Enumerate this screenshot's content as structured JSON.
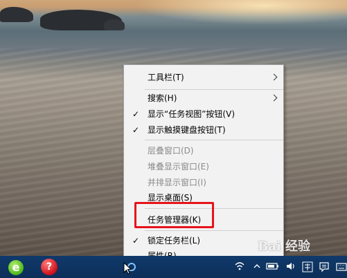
{
  "context_menu": {
    "items": [
      {
        "label": "工具栏(T)",
        "submenu": true
      },
      {
        "label": "搜索(H)",
        "submenu": true
      },
      {
        "label": "显示“任务视图”按钮(V)",
        "checked": true
      },
      {
        "label": "显示触摸键盘按钮(T)",
        "checked": true
      },
      {
        "label": "层叠窗口(D)",
        "disabled": true
      },
      {
        "label": "堆叠显示窗口(E)",
        "disabled": true
      },
      {
        "label": "并排显示窗口(I)",
        "disabled": true
      },
      {
        "label": "显示桌面(S)"
      },
      {
        "label": "任务管理器(K)",
        "highlighted": true
      },
      {
        "label": "锁定任务栏(L)",
        "checked": true
      },
      {
        "label": "属性(R)"
      }
    ],
    "check_mark": "✓"
  },
  "highlight_color": "#e8121a",
  "taskbar": {
    "icons": [
      "ie-icon",
      "red-app-icon",
      "blue-app-icon"
    ],
    "tray_icons": [
      "wifi-icon",
      "chevron-up-icon",
      "battery-icon",
      "volume-icon",
      "language-icon",
      "notification-icon",
      "keyboard-icon"
    ]
  },
  "watermark": "Bai 经验"
}
